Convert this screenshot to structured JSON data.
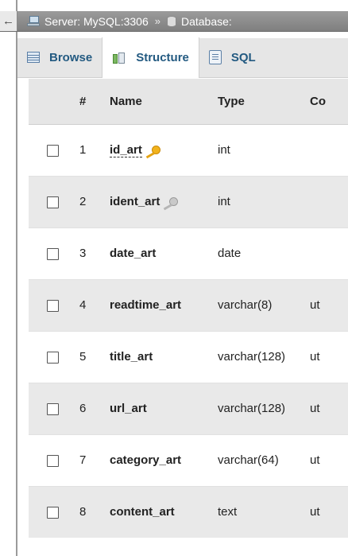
{
  "breadcrumb": {
    "server": "Server: MySQL:3306",
    "separator": "»",
    "database": "Database:"
  },
  "tabs": [
    {
      "label": "Browse",
      "icon": "browse-icon",
      "active": false
    },
    {
      "label": "Structure",
      "icon": "structure-icon",
      "active": true
    },
    {
      "label": "SQL",
      "icon": "sql-icon",
      "active": false
    }
  ],
  "table": {
    "headers": {
      "num": "#",
      "name": "Name",
      "type": "Type",
      "collation": "Co"
    },
    "rows": [
      {
        "num": "1",
        "name": "id_art",
        "type": "int",
        "collation": "",
        "key": "primary"
      },
      {
        "num": "2",
        "name": "ident_art",
        "type": "int",
        "collation": "",
        "key": "index"
      },
      {
        "num": "3",
        "name": "date_art",
        "type": "date",
        "collation": "",
        "key": ""
      },
      {
        "num": "4",
        "name": "readtime_art",
        "type": "varchar(8)",
        "collation": "ut",
        "key": ""
      },
      {
        "num": "5",
        "name": "title_art",
        "type": "varchar(128)",
        "collation": "ut",
        "key": ""
      },
      {
        "num": "6",
        "name": "url_art",
        "type": "varchar(128)",
        "collation": "ut",
        "key": ""
      },
      {
        "num": "7",
        "name": "category_art",
        "type": "varchar(64)",
        "collation": "ut",
        "key": ""
      },
      {
        "num": "8",
        "name": "content_art",
        "type": "text",
        "collation": "ut",
        "key": ""
      }
    ]
  },
  "colors": {
    "tab_text": "#235a81",
    "breadcrumb_bg": "#8c8c8c",
    "row_alt_bg": "#e9e9e9",
    "primary_key": "#f2b31c"
  }
}
